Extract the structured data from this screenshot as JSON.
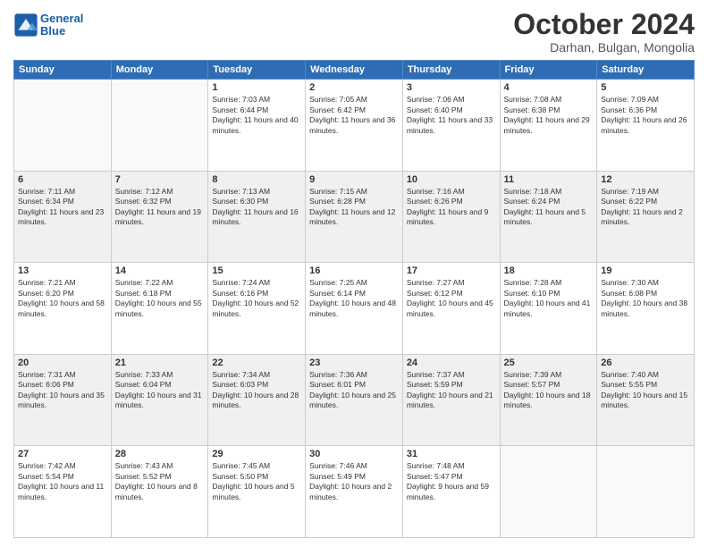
{
  "logo": {
    "line1": "General",
    "line2": "Blue"
  },
  "title": "October 2024",
  "subtitle": "Darhan, Bulgan, Mongolia",
  "days_header": [
    "Sunday",
    "Monday",
    "Tuesday",
    "Wednesday",
    "Thursday",
    "Friday",
    "Saturday"
  ],
  "weeks": [
    {
      "shaded": false,
      "days": [
        {
          "num": "",
          "info": ""
        },
        {
          "num": "",
          "info": ""
        },
        {
          "num": "1",
          "info": "Sunrise: 7:03 AM\nSunset: 6:44 PM\nDaylight: 11 hours and 40 minutes."
        },
        {
          "num": "2",
          "info": "Sunrise: 7:05 AM\nSunset: 6:42 PM\nDaylight: 11 hours and 36 minutes."
        },
        {
          "num": "3",
          "info": "Sunrise: 7:06 AM\nSunset: 6:40 PM\nDaylight: 11 hours and 33 minutes."
        },
        {
          "num": "4",
          "info": "Sunrise: 7:08 AM\nSunset: 6:38 PM\nDaylight: 11 hours and 29 minutes."
        },
        {
          "num": "5",
          "info": "Sunrise: 7:09 AM\nSunset: 6:36 PM\nDaylight: 11 hours and 26 minutes."
        }
      ]
    },
    {
      "shaded": true,
      "days": [
        {
          "num": "6",
          "info": "Sunrise: 7:11 AM\nSunset: 6:34 PM\nDaylight: 11 hours and 23 minutes."
        },
        {
          "num": "7",
          "info": "Sunrise: 7:12 AM\nSunset: 6:32 PM\nDaylight: 11 hours and 19 minutes."
        },
        {
          "num": "8",
          "info": "Sunrise: 7:13 AM\nSunset: 6:30 PM\nDaylight: 11 hours and 16 minutes."
        },
        {
          "num": "9",
          "info": "Sunrise: 7:15 AM\nSunset: 6:28 PM\nDaylight: 11 hours and 12 minutes."
        },
        {
          "num": "10",
          "info": "Sunrise: 7:16 AM\nSunset: 6:26 PM\nDaylight: 11 hours and 9 minutes."
        },
        {
          "num": "11",
          "info": "Sunrise: 7:18 AM\nSunset: 6:24 PM\nDaylight: 11 hours and 5 minutes."
        },
        {
          "num": "12",
          "info": "Sunrise: 7:19 AM\nSunset: 6:22 PM\nDaylight: 11 hours and 2 minutes."
        }
      ]
    },
    {
      "shaded": false,
      "days": [
        {
          "num": "13",
          "info": "Sunrise: 7:21 AM\nSunset: 6:20 PM\nDaylight: 10 hours and 58 minutes."
        },
        {
          "num": "14",
          "info": "Sunrise: 7:22 AM\nSunset: 6:18 PM\nDaylight: 10 hours and 55 minutes."
        },
        {
          "num": "15",
          "info": "Sunrise: 7:24 AM\nSunset: 6:16 PM\nDaylight: 10 hours and 52 minutes."
        },
        {
          "num": "16",
          "info": "Sunrise: 7:25 AM\nSunset: 6:14 PM\nDaylight: 10 hours and 48 minutes."
        },
        {
          "num": "17",
          "info": "Sunrise: 7:27 AM\nSunset: 6:12 PM\nDaylight: 10 hours and 45 minutes."
        },
        {
          "num": "18",
          "info": "Sunrise: 7:28 AM\nSunset: 6:10 PM\nDaylight: 10 hours and 41 minutes."
        },
        {
          "num": "19",
          "info": "Sunrise: 7:30 AM\nSunset: 6:08 PM\nDaylight: 10 hours and 38 minutes."
        }
      ]
    },
    {
      "shaded": true,
      "days": [
        {
          "num": "20",
          "info": "Sunrise: 7:31 AM\nSunset: 6:06 PM\nDaylight: 10 hours and 35 minutes."
        },
        {
          "num": "21",
          "info": "Sunrise: 7:33 AM\nSunset: 6:04 PM\nDaylight: 10 hours and 31 minutes."
        },
        {
          "num": "22",
          "info": "Sunrise: 7:34 AM\nSunset: 6:03 PM\nDaylight: 10 hours and 28 minutes."
        },
        {
          "num": "23",
          "info": "Sunrise: 7:36 AM\nSunset: 6:01 PM\nDaylight: 10 hours and 25 minutes."
        },
        {
          "num": "24",
          "info": "Sunrise: 7:37 AM\nSunset: 5:59 PM\nDaylight: 10 hours and 21 minutes."
        },
        {
          "num": "25",
          "info": "Sunrise: 7:39 AM\nSunset: 5:57 PM\nDaylight: 10 hours and 18 minutes."
        },
        {
          "num": "26",
          "info": "Sunrise: 7:40 AM\nSunset: 5:55 PM\nDaylight: 10 hours and 15 minutes."
        }
      ]
    },
    {
      "shaded": false,
      "days": [
        {
          "num": "27",
          "info": "Sunrise: 7:42 AM\nSunset: 5:54 PM\nDaylight: 10 hours and 11 minutes."
        },
        {
          "num": "28",
          "info": "Sunrise: 7:43 AM\nSunset: 5:52 PM\nDaylight: 10 hours and 8 minutes."
        },
        {
          "num": "29",
          "info": "Sunrise: 7:45 AM\nSunset: 5:50 PM\nDaylight: 10 hours and 5 minutes."
        },
        {
          "num": "30",
          "info": "Sunrise: 7:46 AM\nSunset: 5:49 PM\nDaylight: 10 hours and 2 minutes."
        },
        {
          "num": "31",
          "info": "Sunrise: 7:48 AM\nSunset: 5:47 PM\nDaylight: 9 hours and 59 minutes."
        },
        {
          "num": "",
          "info": ""
        },
        {
          "num": "",
          "info": ""
        }
      ]
    }
  ]
}
